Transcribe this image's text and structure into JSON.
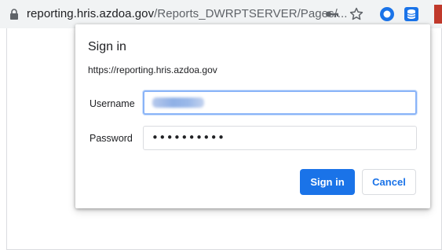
{
  "browser": {
    "url_host": "reporting.hris.azdoa.gov",
    "url_path": "/Reports_DWRPTSERVER/Pages/..."
  },
  "dialog": {
    "title": "Sign in",
    "origin": "https://reporting.hris.azdoa.gov",
    "username_label": "Username",
    "password_label": "Password",
    "password_mask": "••••••••••",
    "signin_label": "Sign in",
    "cancel_label": "Cancel"
  },
  "colors": {
    "primary": "#1a73e8",
    "focus_ring": "#8ab4f8",
    "toolbar_bg": "#f1f3f4"
  }
}
